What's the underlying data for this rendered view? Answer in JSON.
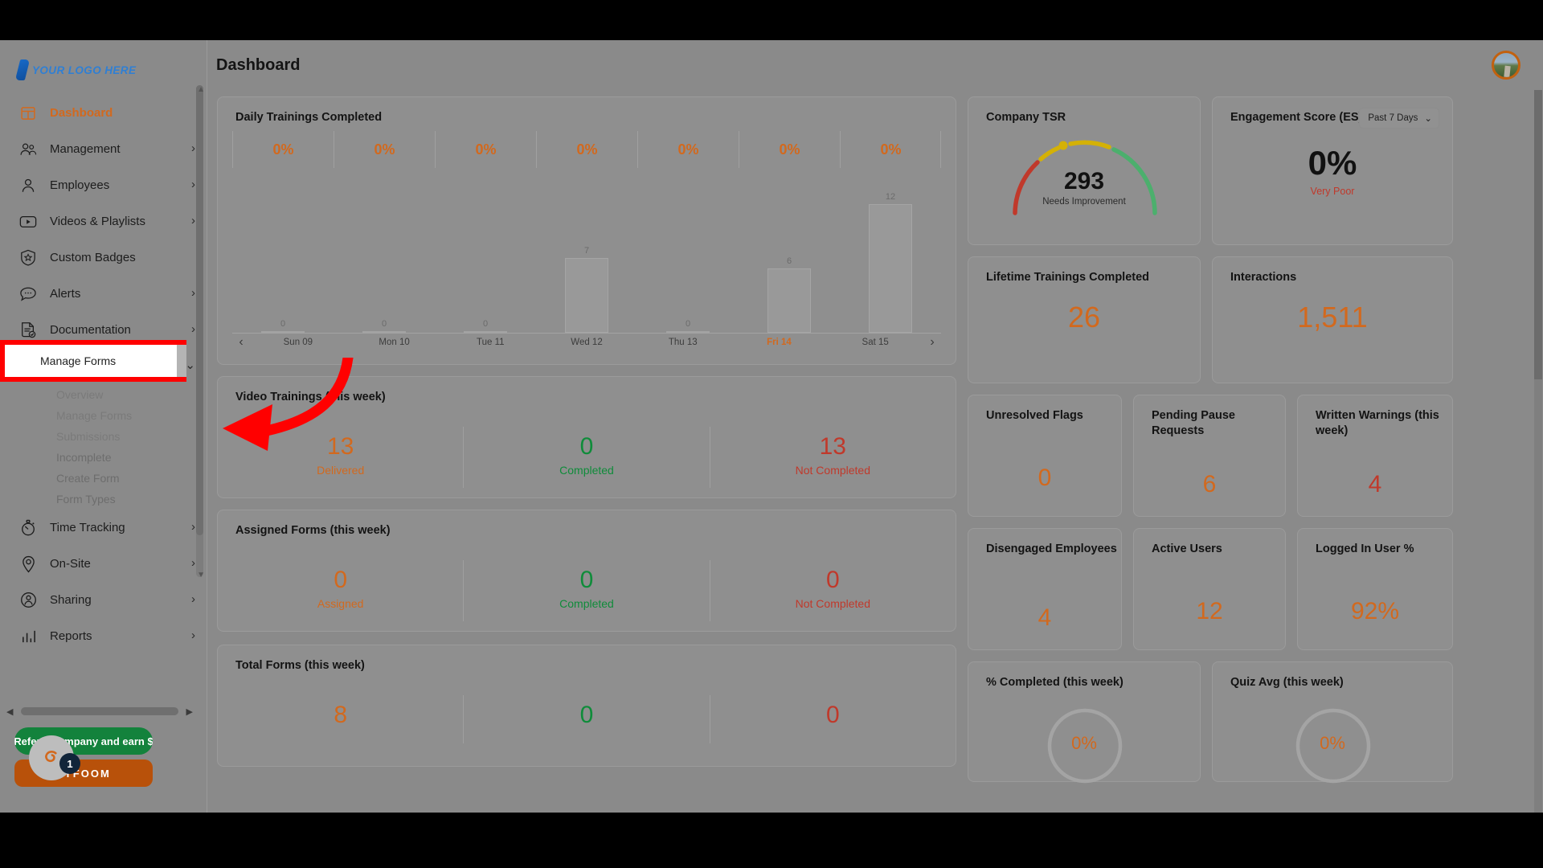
{
  "header": {
    "title": "Dashboard",
    "avatar_name": "user-avatar"
  },
  "sidebar": {
    "logo_text": "YOUR LOGO HERE",
    "items": [
      {
        "label": "Dashboard",
        "icon": "dashboard-icon",
        "active": true,
        "chevron": ""
      },
      {
        "label": "Management",
        "icon": "management-icon",
        "active": false,
        "chevron": "›"
      },
      {
        "label": "Employees",
        "icon": "employees-icon",
        "active": false,
        "chevron": "›"
      },
      {
        "label": "Videos & Playlists",
        "icon": "video-icon",
        "active": false,
        "chevron": "›"
      },
      {
        "label": "Custom Badges",
        "icon": "badge-icon",
        "active": false,
        "chevron": ""
      },
      {
        "label": "Alerts",
        "icon": "alerts-icon",
        "active": false,
        "chevron": "›"
      },
      {
        "label": "Documentation",
        "icon": "documentation-icon",
        "active": false,
        "chevron": "›"
      },
      {
        "label": "Forms",
        "icon": "forms-icon",
        "active": false,
        "chevron": "⌄"
      }
    ],
    "forms_subitems": [
      {
        "label": "Overview"
      },
      {
        "label": "Manage Forms"
      },
      {
        "label": "Submissions"
      },
      {
        "label": "Incomplete"
      },
      {
        "label": "Create Form"
      },
      {
        "label": "Form Types"
      }
    ],
    "items_after": [
      {
        "label": "Time Tracking",
        "icon": "time-tracking-icon",
        "chevron": "›"
      },
      {
        "label": "On-Site",
        "icon": "on-site-icon",
        "chevron": "›"
      },
      {
        "label": "Sharing",
        "icon": "sharing-icon",
        "chevron": "›"
      },
      {
        "label": "Reports",
        "icon": "reports-icon",
        "chevron": "›"
      }
    ],
    "highlighted_item": "Manage Forms",
    "refer_button": "Refer a company and earn $",
    "tyfoom_button": "TYFOOM",
    "chat_badge": "1"
  },
  "chart_data": {
    "type": "bar",
    "title": "Daily Trainings Completed",
    "categories": [
      "Sun 09",
      "Mon 10",
      "Tue 11",
      "Wed 12",
      "Thu 13",
      "Fri 14",
      "Sat 15"
    ],
    "values": [
      0,
      0,
      0,
      7,
      0,
      6,
      12
    ],
    "percent_row": [
      "0%",
      "0%",
      "0%",
      "0%",
      "0%",
      "0%",
      "0%"
    ],
    "highlighted_category": "Fri 14",
    "xlabel": "",
    "ylabel": "",
    "ylim": [
      0,
      12
    ],
    "grid": false,
    "prev_label": "‹",
    "next_label": "›"
  },
  "cards": {
    "video_trainings": {
      "title": "Video Trainings (this week)",
      "stats": [
        {
          "value": "13",
          "label": "Delivered",
          "color": "orange"
        },
        {
          "value": "0",
          "label": "Completed",
          "color": "green"
        },
        {
          "value": "13",
          "label": "Not Completed",
          "color": "red"
        }
      ]
    },
    "assigned_forms": {
      "title": "Assigned Forms (this week)",
      "stats": [
        {
          "value": "0",
          "label": "Assigned",
          "color": "orange"
        },
        {
          "value": "0",
          "label": "Completed",
          "color": "green"
        },
        {
          "value": "0",
          "label": "Not Completed",
          "color": "red"
        }
      ]
    },
    "total_forms": {
      "title": "Total Forms (this week)",
      "stats": [
        {
          "value": "8",
          "label": "",
          "color": "orange"
        },
        {
          "value": "0",
          "label": "",
          "color": "green"
        },
        {
          "value": "0",
          "label": "",
          "color": "red"
        }
      ]
    },
    "company_tsr": {
      "title": "Company TSR",
      "value": "293",
      "status": "Needs Improvement"
    },
    "engagement_score": {
      "title": "Engagement Score (ES)",
      "value": "0%",
      "status": "Very Poor",
      "range_selected": "Past 7 Days"
    },
    "lifetime_trainings": {
      "title": "Lifetime Trainings Completed",
      "value": "26"
    },
    "interactions": {
      "title": "Interactions",
      "value": "1,511"
    },
    "unresolved_flags": {
      "title": "Unresolved Flags",
      "value": "0"
    },
    "pending_pause": {
      "title": "Pending Pause Requests",
      "value": "6"
    },
    "written_warnings": {
      "title": "Written Warnings (this week)",
      "value": "4"
    },
    "disengaged": {
      "title": "Disengaged Employees",
      "value": "4"
    },
    "active_users": {
      "title": "Active Users",
      "value": "12"
    },
    "logged_in_pct": {
      "title": "Logged In User %",
      "value": "92%"
    },
    "pct_completed": {
      "title": "% Completed (this week)",
      "value": "0%"
    },
    "quiz_avg": {
      "title": "Quiz Avg (this week)",
      "value": "0%"
    }
  },
  "colors": {
    "accent_orange": "#d2691e",
    "green": "#0f8c3a",
    "red": "#c0392b",
    "highlight_red": "#ff0000",
    "brand_blue": "#2f7fd4"
  }
}
